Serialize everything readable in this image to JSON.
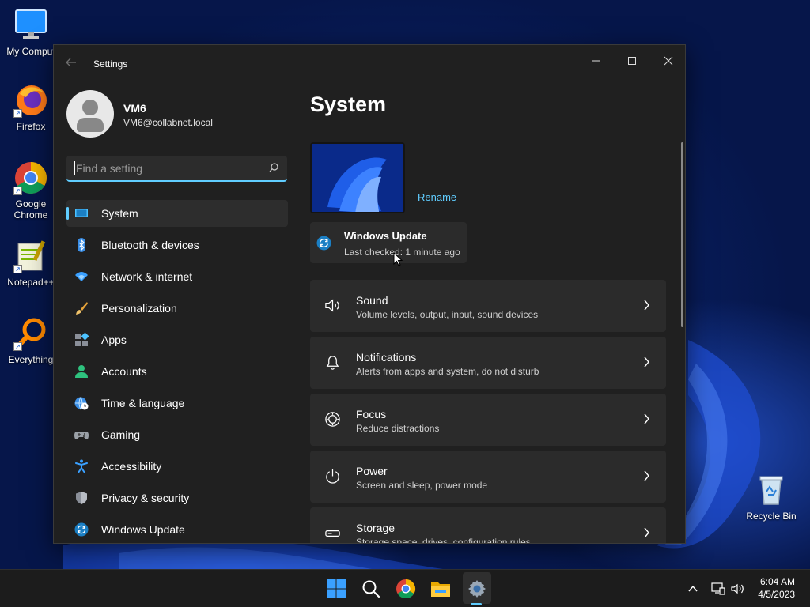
{
  "desktop": {
    "icons": [
      {
        "label": "My Comput",
        "icon": "monitor-icon"
      },
      {
        "label": "Firefox",
        "icon": "firefox-icon"
      },
      {
        "label": "Google Chrome",
        "icon": "chrome-icon"
      },
      {
        "label": "Notepad++",
        "icon": "notepadpp-icon"
      },
      {
        "label": "Everything",
        "icon": "magnifier-icon"
      },
      {
        "label": "Recycle Bin",
        "icon": "recycle-bin-icon"
      }
    ]
  },
  "window": {
    "title": "Settings",
    "controls": {
      "minimize": "minimize",
      "maximize": "maximize",
      "close": "close"
    }
  },
  "profile": {
    "name": "VM6",
    "email": "VM6@collabnet.local"
  },
  "search": {
    "placeholder": "Find a setting",
    "value": ""
  },
  "nav": {
    "items": [
      {
        "label": "System",
        "icon": "display-icon",
        "active": true
      },
      {
        "label": "Bluetooth & devices",
        "icon": "bluetooth-icon"
      },
      {
        "label": "Network & internet",
        "icon": "wifi-icon"
      },
      {
        "label": "Personalization",
        "icon": "brush-icon"
      },
      {
        "label": "Apps",
        "icon": "apps-icon"
      },
      {
        "label": "Accounts",
        "icon": "person-icon"
      },
      {
        "label": "Time & language",
        "icon": "globe-clock-icon"
      },
      {
        "label": "Gaming",
        "icon": "gamepad-icon"
      },
      {
        "label": "Accessibility",
        "icon": "accessibility-icon"
      },
      {
        "label": "Privacy & security",
        "icon": "shield-icon"
      },
      {
        "label": "Windows Update",
        "icon": "update-icon"
      }
    ]
  },
  "main": {
    "title": "System",
    "rename": "Rename",
    "windows_update": {
      "title": "Windows Update",
      "subtitle": "Last checked: 1 minute ago"
    },
    "cards": [
      {
        "title": "Sound",
        "desc": "Volume levels, output, input, sound devices",
        "icon": "speaker-icon"
      },
      {
        "title": "Notifications",
        "desc": "Alerts from apps and system, do not disturb",
        "icon": "bell-icon"
      },
      {
        "title": "Focus",
        "desc": "Reduce distractions",
        "icon": "focus-icon"
      },
      {
        "title": "Power",
        "desc": "Screen and sleep, power mode",
        "icon": "power-icon"
      },
      {
        "title": "Storage",
        "desc": "Storage space, drives, configuration rules",
        "icon": "storage-icon"
      }
    ]
  },
  "taskbar": {
    "apps": [
      "start-icon",
      "search-icon",
      "chrome-icon",
      "file-explorer-icon",
      "settings-icon"
    ],
    "clock": {
      "time": "6:04 AM",
      "date": "4/5/2023"
    }
  },
  "colors": {
    "accent": "#60cdff",
    "window_bg": "#202020",
    "card_bg": "#2b2b2b"
  }
}
